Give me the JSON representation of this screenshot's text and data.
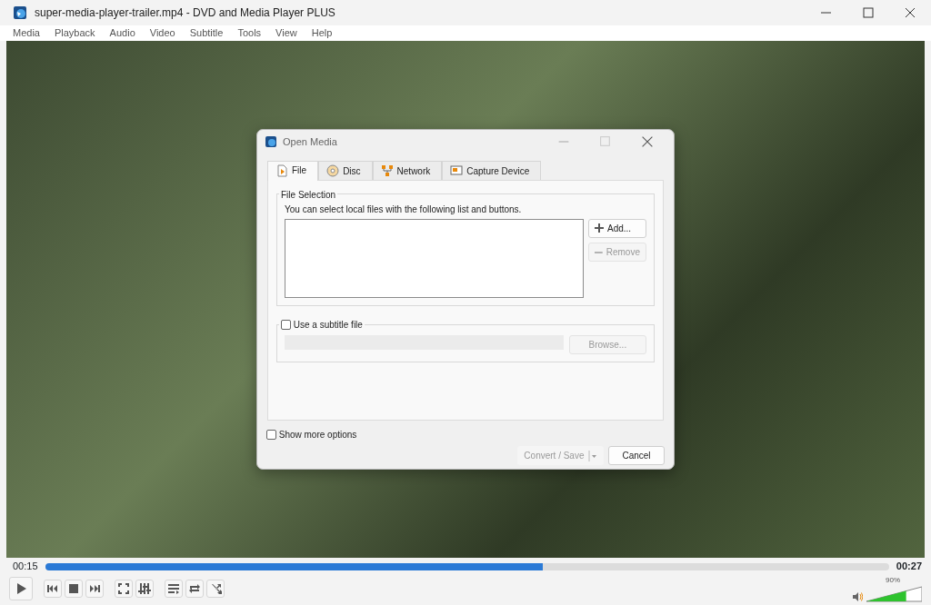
{
  "window": {
    "title": "super-media-player-trailer.mp4 - DVD and Media Player PLUS"
  },
  "menu": [
    "Media",
    "Playback",
    "Audio",
    "Video",
    "Subtitle",
    "Tools",
    "View",
    "Help"
  ],
  "dialog": {
    "title": "Open Media",
    "tabs": [
      {
        "label": "File",
        "selected": true
      },
      {
        "label": "Disc",
        "selected": false
      },
      {
        "label": "Network",
        "selected": false
      },
      {
        "label": "Capture Device",
        "selected": false
      }
    ],
    "file_selection": {
      "legend": "File Selection",
      "hint": "You can select local files with the following list and buttons.",
      "buttons": [
        {
          "label": "Add...",
          "disabled": false,
          "kind": "add"
        },
        {
          "label": "Remove",
          "disabled": true,
          "kind": "remove"
        }
      ]
    },
    "subtitle": {
      "label": "Use a subtitle file",
      "checked": false,
      "browse": {
        "label": "Browse...",
        "disabled": true
      }
    },
    "show_more": {
      "label": "Show more options",
      "checked": false
    },
    "buttons": [
      {
        "label": "Convert / Save",
        "disabled": true,
        "kind": "split"
      },
      {
        "label": "Cancel",
        "disabled": false,
        "kind": "plain"
      }
    ]
  },
  "player": {
    "elapsed": "00:15",
    "total": "00:27",
    "progress": {
      "level": 0.59
    },
    "volume": {
      "reading": "90%",
      "level": 0.72
    }
  }
}
